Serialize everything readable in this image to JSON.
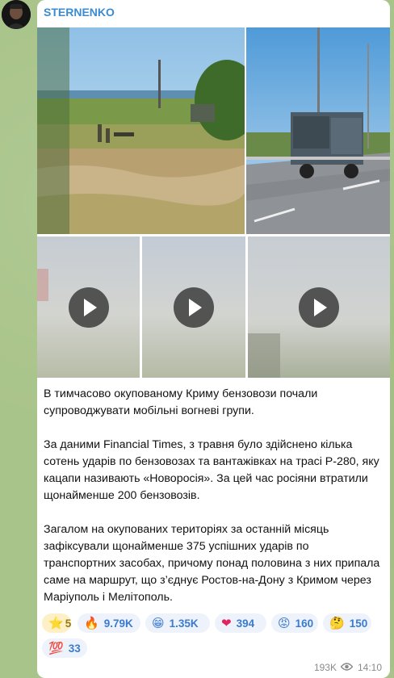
{
  "channel": {
    "name": "STERNENKO"
  },
  "media": {
    "items": [
      {
        "kind": "photo",
        "label": "photo-field-armed-group"
      },
      {
        "kind": "photo",
        "label": "photo-highway-truck"
      },
      {
        "kind": "video",
        "label": "video-1"
      },
      {
        "kind": "video",
        "label": "video-2"
      },
      {
        "kind": "video",
        "label": "video-3"
      }
    ]
  },
  "post": {
    "paragraphs": [
      "В тимчасово окупованому Криму бензовози почали супроводжувати мобільні вогневі групи.",
      "За даними Financial Times, з травня було здійснено кілька сотень ударів по бензовозах та вантажівках на трасі Р-280, яку кацапи називають «Новоросія». За цей час росіяни втратили щонайменше 200 бензовозів.",
      "Загалом на окупованих територіях за останній місяць зафіксували щонайменше 375 успішних ударів по транспортних засобах, причому понад половина з них припала саме на маршрут, що з’єднує Ростов-на-Дону з Кримом через Маріуполь і Мелітополь."
    ]
  },
  "reactions": [
    {
      "emoji": "⭐",
      "count": "5"
    },
    {
      "emoji": "🔥",
      "count": "9.79K"
    },
    {
      "emoji": "😁",
      "count": "1.35K"
    },
    {
      "emoji": "❤",
      "count": "394"
    },
    {
      "emoji": "😡",
      "count": "160"
    },
    {
      "emoji": "🤔",
      "count": "150"
    },
    {
      "emoji": "💯",
      "count": "33"
    }
  ],
  "footer": {
    "views": "193K",
    "time": "14:10"
  },
  "colors": {
    "accent": "#3a8bd1",
    "reaction_bg": "#eef3fb",
    "chat_bg": "#a9c48a"
  }
}
